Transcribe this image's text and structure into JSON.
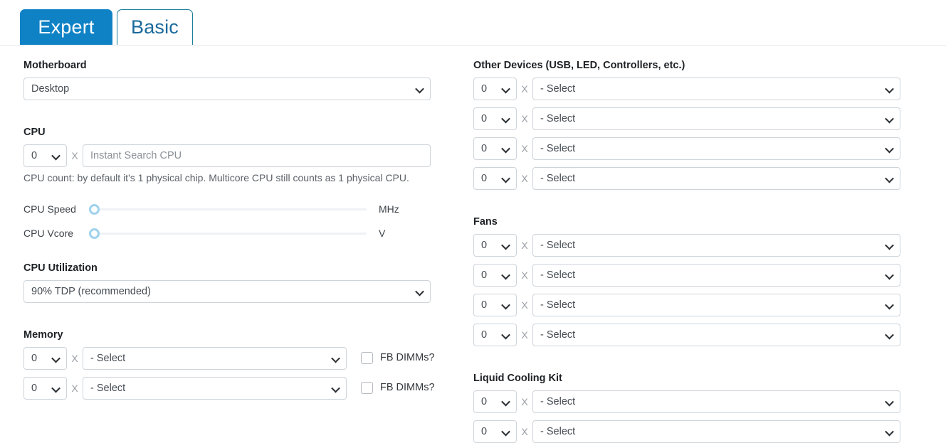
{
  "tabs": [
    {
      "label": "Expert",
      "active": true
    },
    {
      "label": "Basic",
      "active": false
    }
  ],
  "left_column": {
    "motherboard": {
      "label": "Motherboard",
      "select_value": "Desktop"
    },
    "cpu": {
      "label": "CPU",
      "qty_value": "0",
      "multiplier": "X",
      "search_placeholder": "Instant Search CPU",
      "help_text": "CPU count: by default it's 1 physical chip. Multicore CPU still counts as 1 physical CPU."
    },
    "sliders": [
      {
        "name": "CPU Speed",
        "unit": "MHz",
        "value": 0
      },
      {
        "name": "CPU Vcore",
        "unit": "V",
        "value": 0
      }
    ],
    "cpu_utilization": {
      "label": "CPU Utilization",
      "select_value": "90% TDP (recommended)"
    },
    "memory": {
      "label": "Memory",
      "rows": [
        {
          "qty_value": "0",
          "multiplier": "X",
          "select_value": "- Select",
          "checkbox_label": "FB DIMMs?",
          "checked": false
        },
        {
          "qty_value": "0",
          "multiplier": "X",
          "select_value": "- Select",
          "checkbox_label": "FB DIMMs?",
          "checked": false
        }
      ]
    }
  },
  "right_column": {
    "other_devices": {
      "label": "Other Devices (USB, LED, Controllers, etc.)",
      "rows": [
        {
          "qty_value": "0",
          "multiplier": "X",
          "select_value": "- Select"
        },
        {
          "qty_value": "0",
          "multiplier": "X",
          "select_value": "- Select"
        },
        {
          "qty_value": "0",
          "multiplier": "X",
          "select_value": "- Select"
        },
        {
          "qty_value": "0",
          "multiplier": "X",
          "select_value": "- Select"
        }
      ]
    },
    "fans": {
      "label": "Fans",
      "rows": [
        {
          "qty_value": "0",
          "multiplier": "X",
          "select_value": "- Select"
        },
        {
          "qty_value": "0",
          "multiplier": "X",
          "select_value": "- Select"
        },
        {
          "qty_value": "0",
          "multiplier": "X",
          "select_value": "- Select"
        },
        {
          "qty_value": "0",
          "multiplier": "X",
          "select_value": "- Select"
        }
      ]
    },
    "liquid_cooling": {
      "label": "Liquid Cooling Kit",
      "rows": [
        {
          "qty_value": "0",
          "multiplier": "X",
          "select_value": "- Select"
        },
        {
          "qty_value": "0",
          "multiplier": "X",
          "select_value": "- Select"
        }
      ]
    }
  },
  "colors": {
    "tab_active_bg": "#0f82c6",
    "tab_inactive_text": "#19699c",
    "tab_inactive_border": "#1b7e99",
    "control_border": "#ced4da",
    "slider_handle": "#9fd2ee"
  }
}
